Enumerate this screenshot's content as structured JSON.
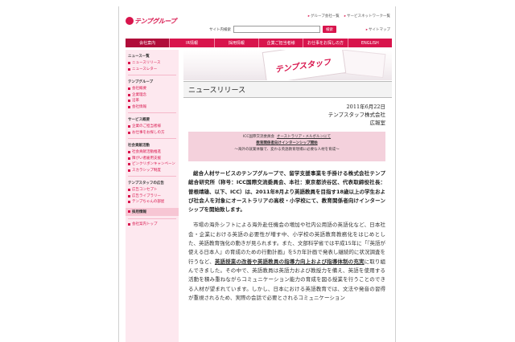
{
  "header": {
    "logo_text": "テンプグループ",
    "top_links": [
      "グループ会社一覧",
      "サービスネットワーク一覧"
    ],
    "search_label": "サイト内検索",
    "search_button": "検索",
    "sitemap": "サイトマップ"
  },
  "nav": {
    "items": [
      "会社案内",
      "IR情報",
      "採用情報",
      "企業ご担当者様",
      "お仕事をお探しの方",
      "ENGLISH"
    ],
    "active_index": 0
  },
  "sidebar": {
    "sections": [
      {
        "head": "ニュース一覧",
        "items": [
          "ニュースリリース",
          "ニュースレター"
        ]
      },
      {
        "head": "テンプグループ",
        "items": [
          "会社概要",
          "企業理念",
          "沿革",
          "会社情報"
        ]
      },
      {
        "head": "サービス概要",
        "items": [
          "企業のご担当者様",
          "お仕事をお探しの方"
        ]
      },
      {
        "head": "社会貢献活動",
        "items": [
          "社会貢献活動推進",
          "障がい者雇用支援",
          "ピンクリボンキャンペーン",
          "スカラシップ制度"
        ]
      },
      {
        "head": "テンプスタッフの広告",
        "items": [
          "広告コンセプト",
          "広告ライブラリー",
          "テンプちゃんの部屋"
        ]
      }
    ],
    "active_head": "採用情報",
    "last_item": "会社案内トップ"
  },
  "hero": {
    "card_text": "テンプスタッフ"
  },
  "article": {
    "title": "ニュースリリース",
    "date": "2011年6月22日",
    "company": "テンプスタッフ株式会社",
    "dept": "広報室",
    "banner": {
      "line1_a": "ICC国際交流委員会",
      "line1_b": "オーストラリア・メルボルンにて",
      "line2": "教育関係者向けインターンシップ開始",
      "line3": "〜海外の就業体験で、変わる英語教育現場に必要な人材を育成〜"
    },
    "lead": "総合人材サービスのテンプグループで、留学支援事業を手掛ける株式会社テンプ総合研究所（称号：ICC国際交流委員会、本社：東京都渋谷区、代表取締役社長：曽根靖雄、以下、ICC）は、2011年8月より英語教員を目指す18歳以上の学生および社会人を対象にオーストラリアの高校・小学校にて、教育関係者向けインターンシップを開始致します。",
    "body_before": "市場の海外シフトによる海外赴任機会の増加や社内公用語の英語化など、日本社会・企業における英語の必要性が増す中、小学校の英語教育教務化をはじめとした、英語教育強化の動きが見られます。また、文部科学省では平成15年に「『英語が使える日本人』の育成のための行動計画」を5カ年計画で発表し継続的に状況調査を行うなど、",
    "body_highlight": "英語授業の改善や英語教員の指導力向上および指導体制の充実",
    "body_after": "に取り組んできました。その中で、英語教員は英語力および教授力を備え、英語を使用する活動を積み重ねながらコミュニケーション能力の育成を図る授業を行うことのできる人材が望まれています。しかし、日本における英語教育では、文法や発音の習得が重視されるため、実際の会話で必要とされるコミュニケーション"
  }
}
